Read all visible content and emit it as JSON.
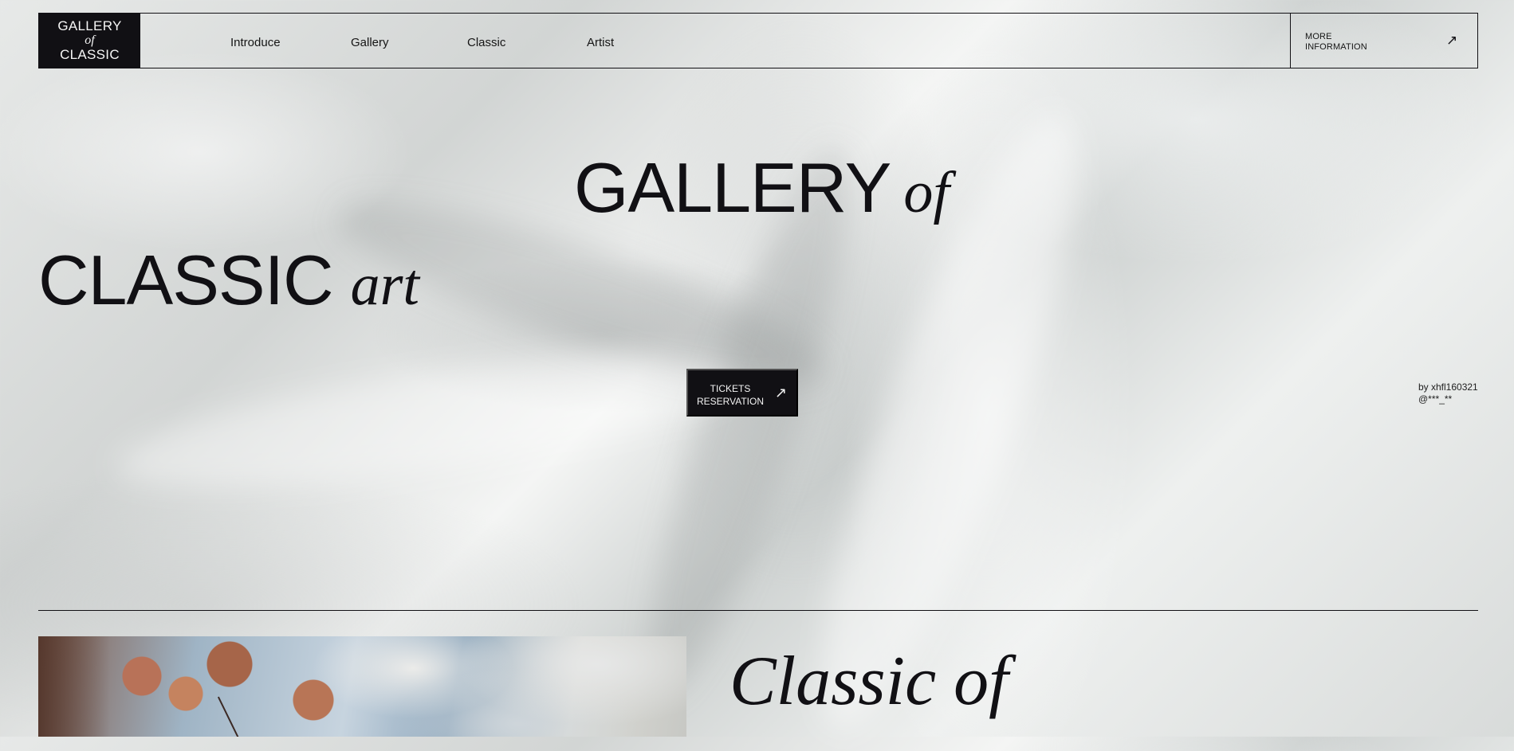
{
  "header": {
    "logo": {
      "line1": "GALLERY",
      "line2": "of",
      "line3": "CLASSIC"
    },
    "nav": [
      {
        "label": "Introduce"
      },
      {
        "label": "Gallery"
      },
      {
        "label": "Classic"
      },
      {
        "label": "Artist"
      }
    ],
    "more_information": {
      "label": "MORE INFORMATION",
      "icon": "arrow-up-right-icon"
    }
  },
  "hero": {
    "title_line1": "GALLERY",
    "title_line1_italic": "of",
    "title_line2": "CLASSIC",
    "title_line2_italic": "art",
    "ticket_button": {
      "label_line1": "TICKETS",
      "label_line2": "RESERVATION",
      "icon": "arrow-up-right-icon"
    },
    "credit": {
      "by": "by xhfl160321",
      "handle": "@***_**"
    }
  },
  "next_section": {
    "heading": "Classic of"
  },
  "colors": {
    "ink": "#111014",
    "silk_light": "#f4f5f4",
    "silk_shadow": "#cdd1d0"
  }
}
